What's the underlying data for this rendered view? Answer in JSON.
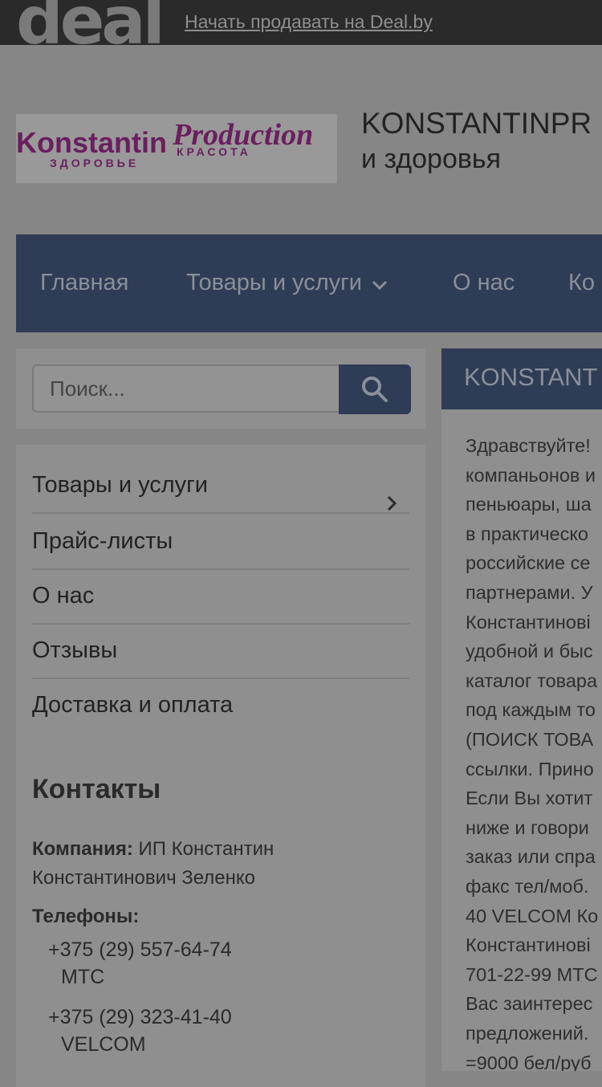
{
  "topbar": {
    "logo_text": "deal",
    "sell_link": "Начать продавать на Deal.by"
  },
  "logo": {
    "word1": "Konstantin",
    "word2": "Production",
    "sub1": "ЗДОРОВЬЕ",
    "sub2": "КРАСОТА"
  },
  "shop_title": {
    "line1": "KONSTANTINPR",
    "line2": "и здоровья"
  },
  "nav": {
    "items": [
      {
        "label": "Главная"
      },
      {
        "label": "Товары и услуги"
      },
      {
        "label": "О нас"
      },
      {
        "label": "Ко"
      }
    ]
  },
  "search": {
    "placeholder": "Поиск..."
  },
  "sidebar": {
    "items": [
      {
        "label": "Товары и услуги"
      },
      {
        "label": "Прайс-листы"
      },
      {
        "label": "О нас"
      },
      {
        "label": "Отзывы"
      },
      {
        "label": "Доставка и оплата"
      }
    ]
  },
  "contacts": {
    "heading": "Контакты",
    "company_label": "Компания:",
    "company_value": "ИП Константин Константинович Зеленко",
    "phones_label": "Телефоны:",
    "phones": [
      {
        "number": "+375 (29) 557-64-74",
        "operator": "МТС"
      },
      {
        "number": "+375 (29) 323-41-40",
        "operator": "VELCOM"
      }
    ]
  },
  "content": {
    "heading": "KONSTANT",
    "lines": [
      "Здравствуйте!",
      "компаньонов и",
      "пеньюары, ша",
      "в практическо",
      "российские се",
      "партнерами. У",
      "Константинові",
      "удобной и быс",
      "каталог товара",
      "под каждым то",
      "(ПОИСК ТОВА",
      "ссылки. Прино",
      "Если Вы хотит",
      "ниже и говори",
      "заказ или спра",
      "факс тел/моб.",
      "40 VELCOM Ко",
      "Константинові",
      "701-22-99 МТС",
      "Вас заинтерес",
      "предложений.",
      "=9000 бел/руб"
    ]
  }
}
